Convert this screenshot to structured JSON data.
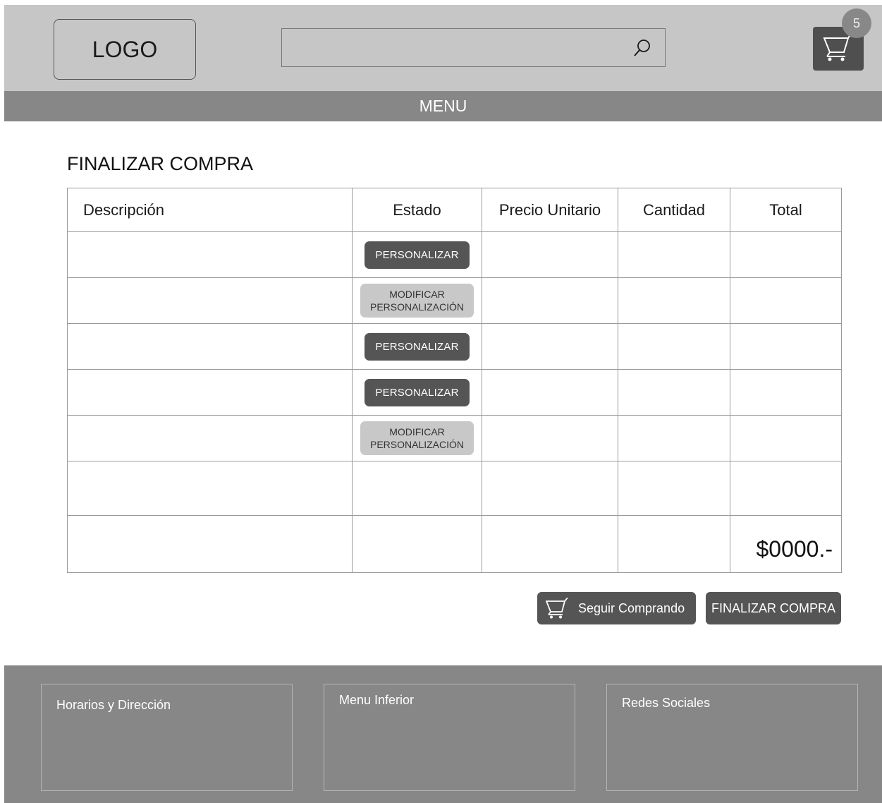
{
  "header": {
    "logo": "LOGO",
    "search_placeholder": "",
    "cart_count": "5"
  },
  "menu": "MENU",
  "page_title": "FINALIZAR COMPRA",
  "table": {
    "headers": [
      "Descripción",
      "Estado",
      "Precio Unitario",
      "Cantidad",
      "Total"
    ],
    "rows": [
      {
        "estado": "PERSONALIZAR",
        "style": "dark"
      },
      {
        "estado_line1": "MODIFICAR",
        "estado_line2": "PERSONALIZACIÓN",
        "style": "light"
      },
      {
        "estado": "PERSONALIZAR",
        "style": "dark"
      },
      {
        "estado": "PERSONALIZAR",
        "style": "dark"
      },
      {
        "estado_line1": "MODIFICAR",
        "estado_line2": "PERSONALIZACIÓN",
        "style": "light"
      }
    ],
    "total": "$0000.-"
  },
  "actions": {
    "keep_shopping": "Seguir Comprando",
    "finish": "FINALIZAR COMPRA"
  },
  "footer": {
    "col1": "Horarios y Dirección",
    "col2": "Menu Inferior",
    "col3": "Redes Sociales"
  },
  "colors": {
    "header_bg": "#c6c6c6",
    "bar_bg": "#878787",
    "button_dark": "#555555",
    "button_light": "#c8c8c8"
  }
}
